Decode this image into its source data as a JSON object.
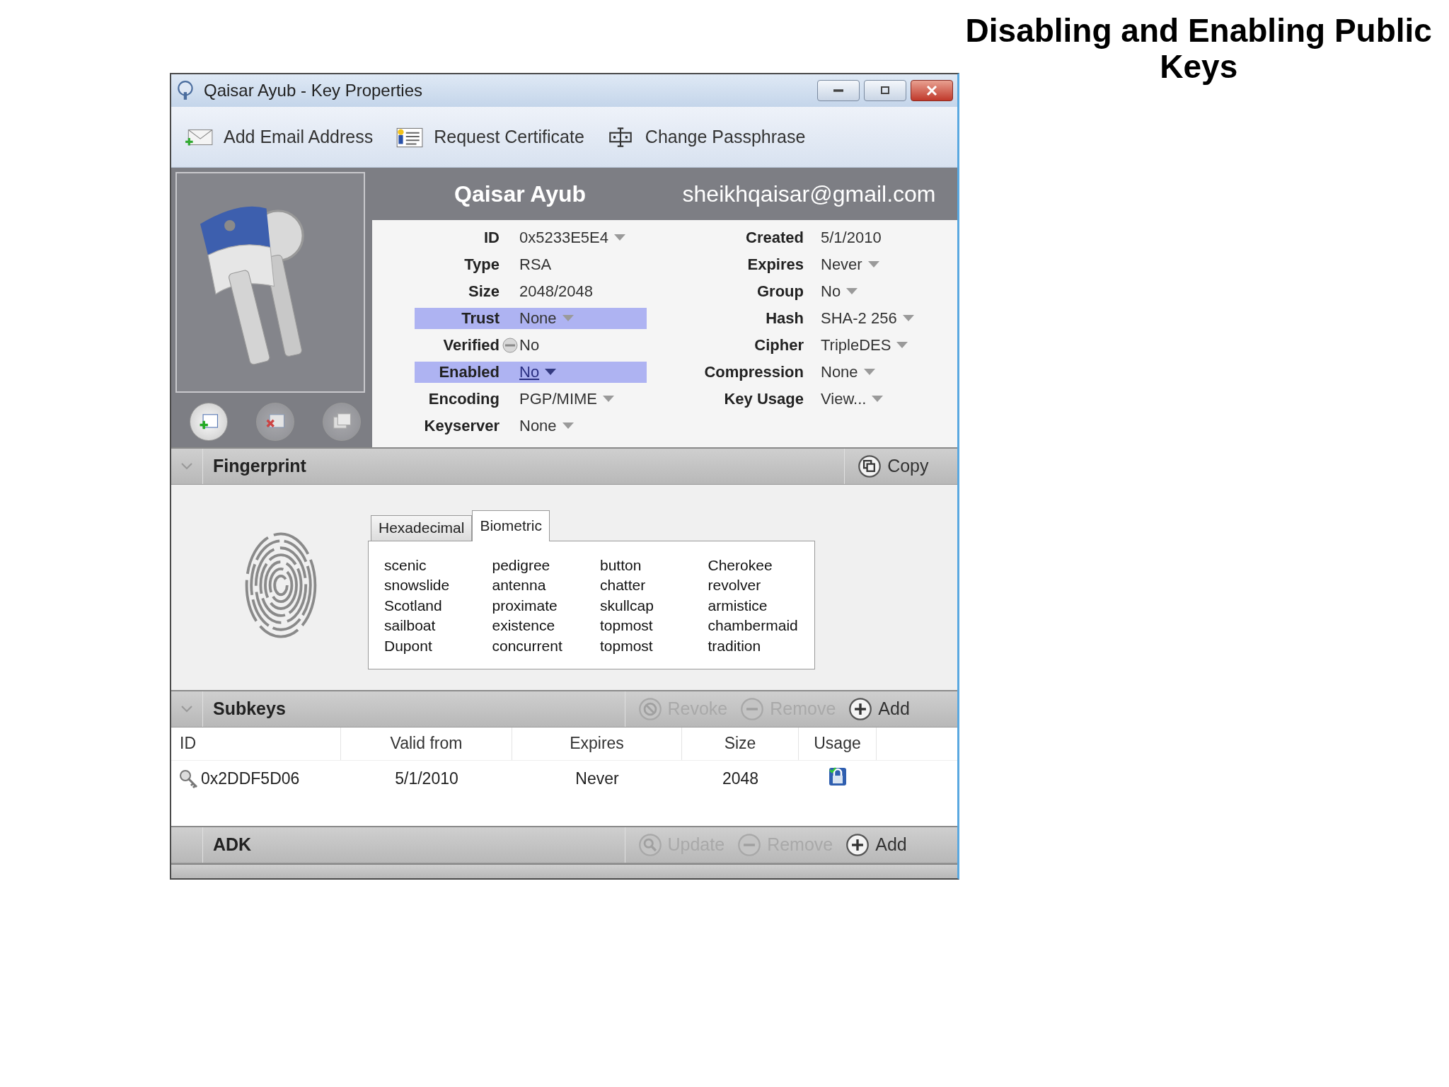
{
  "slide_title": "Disabling and Enabling Public Keys",
  "window": {
    "title": "Qaisar Ayub - Key Properties"
  },
  "toolbar": [
    {
      "label": "Add Email Address",
      "kind": "email"
    },
    {
      "label": "Request Certificate",
      "kind": "certificate"
    },
    {
      "label": "Change Passphrase",
      "kind": "passphrase"
    }
  ],
  "key": {
    "name": "Qaisar Ayub",
    "email": "sheikhqaisar@gmail.com"
  },
  "fields_left": [
    {
      "label": "ID",
      "value": "0x5233E5E4",
      "kind": "dropdown",
      "selected": false
    },
    {
      "label": "Type",
      "value": "RSA",
      "kind": "plain",
      "selected": false
    },
    {
      "label": "Size",
      "value": "2048/2048",
      "kind": "plain",
      "selected": false
    },
    {
      "label": "Trust",
      "value": "None",
      "kind": "dropdown",
      "selected": true
    },
    {
      "label": "Verified",
      "value": "No",
      "kind": "status",
      "selected": false
    },
    {
      "label": "Enabled",
      "value": "No",
      "kind": "active_dropdown",
      "selected": true
    },
    {
      "label": "Encoding",
      "value": "PGP/MIME",
      "kind": "dropdown",
      "selected": false
    },
    {
      "label": "Keyserver",
      "value": "None",
      "kind": "dropdown",
      "selected": false
    }
  ],
  "fields_right": [
    {
      "label": "Created",
      "value": "5/1/2010",
      "kind": "plain",
      "selected": false
    },
    {
      "label": "Expires",
      "value": "Never",
      "kind": "dropdown",
      "selected": false
    },
    {
      "label": "Group",
      "value": "No",
      "kind": "dropdown",
      "selected": false
    },
    {
      "label": "Hash",
      "value": "SHA-2 256",
      "kind": "dropdown",
      "selected": false
    },
    {
      "label": "Cipher",
      "value": "TripleDES",
      "kind": "dropdown",
      "selected": false
    },
    {
      "label": "Compression",
      "value": "None",
      "kind": "dropdown",
      "selected": false
    },
    {
      "label": "Key Usage",
      "value": "View...",
      "kind": "dropdown",
      "selected": false
    }
  ],
  "fingerprint": {
    "title": "Fingerprint",
    "copy_label": "Copy",
    "expanded": true,
    "tabs": [
      {
        "label": "Hexadecimal",
        "selected": false
      },
      {
        "label": "Biometric",
        "selected": true
      }
    ],
    "word_columns": [
      [
        "scenic",
        "snowslide",
        "Scotland",
        "sailboat",
        "Dupont"
      ],
      [
        "pedigree",
        "antenna",
        "proximate",
        "existence",
        "concurrent"
      ],
      [
        "button",
        "chatter",
        "skullcap",
        "topmost",
        "topmost"
      ],
      [
        "Cherokee",
        "revolver",
        "armistice",
        "chambermaid",
        "tradition"
      ]
    ]
  },
  "subkeys": {
    "title": "Subkeys",
    "expanded": true,
    "actions": [
      {
        "label": "Revoke",
        "kind": "revoke",
        "disabled": true
      },
      {
        "label": "Remove",
        "kind": "remove",
        "disabled": true
      },
      {
        "label": "Add",
        "kind": "add",
        "disabled": false
      }
    ],
    "columns": [
      "ID",
      "Valid from",
      "Expires",
      "Size",
      "Usage"
    ],
    "rows": [
      {
        "id": "0x2DDF5D06",
        "valid_from": "5/1/2010",
        "expires": "Never",
        "size": "2048"
      }
    ]
  },
  "adk": {
    "title": "ADK",
    "expanded": false,
    "actions": [
      {
        "label": "Update",
        "kind": "update",
        "disabled": true
      },
      {
        "label": "Remove",
        "kind": "remove",
        "disabled": true
      },
      {
        "label": "Add",
        "kind": "add",
        "disabled": false
      }
    ]
  }
}
